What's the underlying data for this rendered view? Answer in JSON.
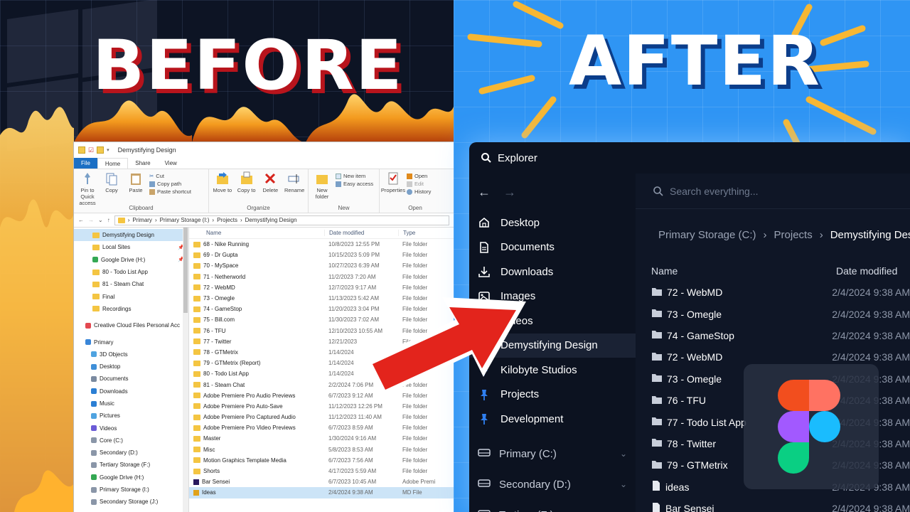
{
  "thumbnail": {
    "before_label": "BEFORE",
    "after_label": "AFTER"
  },
  "old_explorer": {
    "title": "Demystifying Design",
    "tabs": [
      "File",
      "Home",
      "Share",
      "View"
    ],
    "ribbon": {
      "clipboard": {
        "label": "Clipboard",
        "pin_label": "Pin to Quick access",
        "copy_label": "Copy",
        "paste_label": "Paste",
        "cut_label": "Cut",
        "copy_path_label": "Copy path",
        "paste_shortcut_label": "Paste shortcut"
      },
      "organize": {
        "label": "Organize",
        "move_label": "Move to",
        "copy_label": "Copy to",
        "delete_label": "Delete",
        "rename_label": "Rename"
      },
      "new": {
        "label": "New",
        "new_folder_label": "New folder",
        "new_item_label": "New item",
        "easy_access_label": "Easy access"
      },
      "open": {
        "label": "Open",
        "properties_label": "Properties",
        "open_label": "Open",
        "edit_label": "Edit",
        "history_label": "History"
      }
    },
    "address_path": [
      "Primary",
      "Primary Storage (I:)",
      "Projects",
      "Demystifying Design"
    ],
    "nav_items": [
      {
        "label": "Demystifying Design",
        "kind": "folder",
        "pinned": false,
        "selected": true
      },
      {
        "label": "Local Sites",
        "kind": "folder",
        "pinned": true
      },
      {
        "label": "Google Drive (H:)",
        "kind": "gdrive",
        "pinned": true
      },
      {
        "label": "80 - Todo List App",
        "kind": "folder"
      },
      {
        "label": "81 - Steam Chat",
        "kind": "folder"
      },
      {
        "label": "Final",
        "kind": "folder"
      },
      {
        "label": "Recordings",
        "kind": "folder"
      },
      {
        "label": "",
        "kind": "spacer"
      },
      {
        "label": "Creative Cloud Files Personal Acc",
        "kind": "cc"
      },
      {
        "label": "",
        "kind": "spacer"
      },
      {
        "label": "Primary",
        "kind": "pc"
      },
      {
        "label": "3D Objects",
        "kind": "obj"
      },
      {
        "label": "Desktop",
        "kind": "desk"
      },
      {
        "label": "Documents",
        "kind": "docs"
      },
      {
        "label": "Downloads",
        "kind": "dl"
      },
      {
        "label": "Music",
        "kind": "music"
      },
      {
        "label": "Pictures",
        "kind": "pic"
      },
      {
        "label": "Videos",
        "kind": "vid"
      },
      {
        "label": "Core (C:)",
        "kind": "drive"
      },
      {
        "label": "Secondary (D:)",
        "kind": "drive"
      },
      {
        "label": "Tertiary Storage (F:)",
        "kind": "drive"
      },
      {
        "label": "Google Drive (H:)",
        "kind": "gdrive"
      },
      {
        "label": "Primary Storage (I:)",
        "kind": "drive"
      },
      {
        "label": "Secondary Storage (J:)",
        "kind": "drive"
      }
    ],
    "columns": {
      "name": "Name",
      "date": "Date modified",
      "type": "Type"
    },
    "rows": [
      {
        "name": "68 - Nike Running",
        "date": "10/8/2023 12:55 PM",
        "type": "File folder"
      },
      {
        "name": "69 - Dr Gupta",
        "date": "10/15/2023 5:09 PM",
        "type": "File folder"
      },
      {
        "name": "70 - MySpace",
        "date": "10/27/2023 6:39 AM",
        "type": "File folder"
      },
      {
        "name": "71 - Netherworld",
        "date": "11/2/2023 7:20 AM",
        "type": "File folder"
      },
      {
        "name": "72 - WebMD",
        "date": "12/7/2023 9:17 AM",
        "type": "File folder"
      },
      {
        "name": "73 - Omegle",
        "date": "11/13/2023 5:42 AM",
        "type": "File folder"
      },
      {
        "name": "74 - GameStop",
        "date": "11/20/2023 3:04 PM",
        "type": "File folder"
      },
      {
        "name": "75 - Bill.com",
        "date": "11/30/2023 7:02 AM",
        "type": "File folder"
      },
      {
        "name": "76 - TFU",
        "date": "12/10/2023 10:55 AM",
        "type": "File folder"
      },
      {
        "name": "77 - Twitter",
        "date": "12/21/2023",
        "type": "File folder"
      },
      {
        "name": "78 - GTMetrix",
        "date": "1/14/2024",
        "type": "File folder"
      },
      {
        "name": "79 - GTMetrix (Report)",
        "date": "1/14/2024",
        "type": "File folder"
      },
      {
        "name": "80 - Todo List App",
        "date": "1/14/2024",
        "type": "File folder"
      },
      {
        "name": "81 - Steam Chat",
        "date": "2/2/2024 7:06 PM",
        "type": "File folder"
      },
      {
        "name": "Adobe Premiere Pro Audio Previews",
        "date": "6/7/2023 9:12 AM",
        "type": "File folder"
      },
      {
        "name": "Adobe Premiere Pro Auto-Save",
        "date": "11/12/2023 12:26 PM",
        "type": "File folder"
      },
      {
        "name": "Adobe Premiere Pro Captured Audio",
        "date": "11/12/2023 11:40 AM",
        "type": "File folder"
      },
      {
        "name": "Adobe Premiere Pro Video Previews",
        "date": "6/7/2023 8:59 AM",
        "type": "File folder"
      },
      {
        "name": "Master",
        "date": "1/30/2024 9:16 AM",
        "type": "File folder"
      },
      {
        "name": "Misc",
        "date": "5/8/2023 8:53 AM",
        "type": "File folder"
      },
      {
        "name": "Motion Graphics Template Media",
        "date": "6/7/2023 7:56 AM",
        "type": "File folder"
      },
      {
        "name": "Shorts",
        "date": "4/17/2023 5:59 AM",
        "type": "File folder"
      },
      {
        "name": "Bar Sensei",
        "date": "6/7/2023 10:45 AM",
        "type": "Adobe Premi"
      },
      {
        "name": "Ideas",
        "date": "2/4/2024 9:38 AM",
        "type": "MD File",
        "selected": true
      }
    ]
  },
  "new_explorer": {
    "title": "Explorer",
    "search_placeholder": "Search everything...",
    "nav_items": [
      {
        "label": "Desktop",
        "icon": "home-icon"
      },
      {
        "label": "Documents",
        "icon": "document-icon"
      },
      {
        "label": "Downloads",
        "icon": "download-icon"
      },
      {
        "label": "Images",
        "icon": "image-icon"
      },
      {
        "label": "Videos",
        "icon": "video-icon"
      }
    ],
    "pinned_items": [
      {
        "label": "Demystifying Design",
        "selected": true
      },
      {
        "label": "Kilobyte Studios"
      },
      {
        "label": "Projects"
      },
      {
        "label": "Development"
      }
    ],
    "drives": [
      {
        "label": "Primary (C:)"
      },
      {
        "label": "Secondary (D:)"
      },
      {
        "label": "Tertiary (F:)"
      }
    ],
    "breadcrumb": [
      "Primary Storage (C:)",
      "Projects",
      "Demystifying Design"
    ],
    "columns": {
      "name": "Name",
      "date": "Date modified"
    },
    "rows": [
      {
        "name": "72 - WebMD",
        "date": "2/4/2024 9:38 AM",
        "kind": "folder"
      },
      {
        "name": "73 - Omegle",
        "date": "2/4/2024 9:38 AM",
        "kind": "folder"
      },
      {
        "name": "74 - GameStop",
        "date": "2/4/2024 9:38 AM",
        "kind": "folder"
      },
      {
        "name": "72 - WebMD",
        "date": "2/4/2024 9:38 AM",
        "kind": "folder"
      },
      {
        "name": "73 - Omegle",
        "date": "2/4/2024 9:38 AM",
        "kind": "folder"
      },
      {
        "name": "76 - TFU",
        "date": "2/4/2024 9:38 AM",
        "kind": "folder"
      },
      {
        "name": "77 - Todo List App",
        "date": "2/4/2024 9:38 AM",
        "kind": "folder"
      },
      {
        "name": "78 - Twitter",
        "date": "2/4/2024 9:38 AM",
        "kind": "folder"
      },
      {
        "name": "79 - GTMetrix",
        "date": "2/4/2024 9:38 AM",
        "kind": "folder"
      },
      {
        "name": "ideas",
        "date": "2/4/2024 9:38 AM",
        "kind": "file"
      },
      {
        "name": "Bar Sensei",
        "date": "2/4/2024 9:38 AM",
        "kind": "file"
      }
    ]
  },
  "colors": {
    "after_background": "#2f95f4",
    "before_background": "#0d1424",
    "arrow_red": "#e3241c",
    "ray_yellow": "#f7b733",
    "dark_panel": "#0c1220"
  }
}
